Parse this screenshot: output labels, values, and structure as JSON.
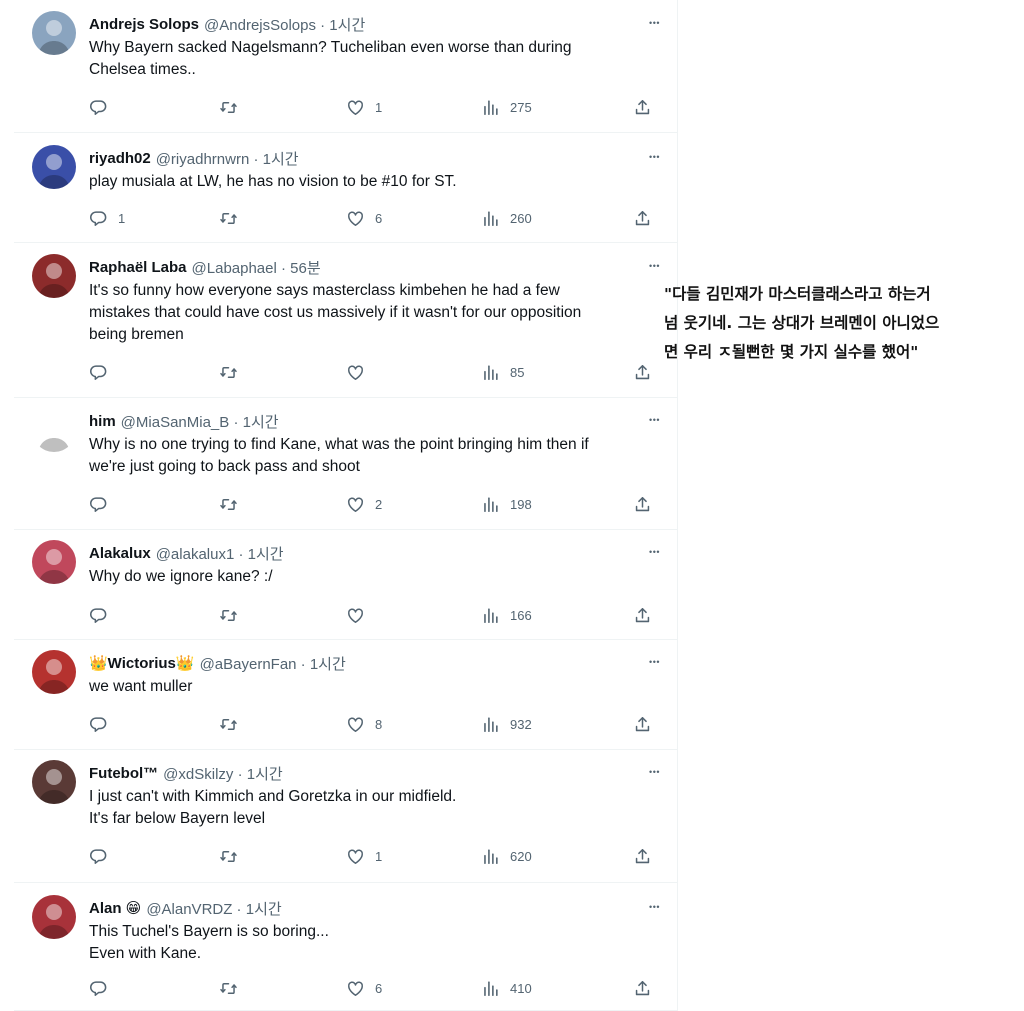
{
  "tweets": [
    {
      "name": "Andrejs Solops",
      "handle": "@AndrejsSolops · 1시간",
      "lines": [
        "Why Bayern sacked Nagelsmann? Tucheliban even worse than during",
        "Chelsea times.."
      ],
      "reply": "",
      "retweet": "",
      "like": "1",
      "views": "275",
      "avatar_color": "#8aa4bf"
    },
    {
      "name": "riyadh02",
      "handle": "@riyadhrnwrn · 1시간",
      "lines": [
        "play musiala at LW, he has no vision to be #10 for ST."
      ],
      "reply": "1",
      "retweet": "",
      "like": "6",
      "views": "260",
      "avatar_color": "#3a4fa8"
    },
    {
      "name": "Raphaël Laba",
      "handle": "@Labaphael · 56분",
      "lines": [
        "It's so funny how everyone says masterclass kimbehen he had a few",
        "mistakes that could have cost us massively if it wasn't for our opposition",
        "being bremen"
      ],
      "reply": "",
      "retweet": "",
      "like": "",
      "views": "85",
      "avatar_color": "#8c2b2b"
    },
    {
      "name": "him",
      "handle": "@MiaSanMia_B · 1시간",
      "lines": [
        "Why is no one trying to find Kane, what was the point bringing him then if",
        "we're just going to back pass and shoot"
      ],
      "reply": "",
      "retweet": "",
      "like": "2",
      "views": "198",
      "avatar_color": "#ffffff"
    },
    {
      "name": "Alakalux",
      "handle": "@alakalux1 · 1시간",
      "lines": [
        "Why  do we ignore kane? :/"
      ],
      "reply": "",
      "retweet": "",
      "like": "",
      "views": "166",
      "avatar_color": "#c0485c"
    },
    {
      "name": "👑Wictorius👑",
      "handle": "@aBayernFan · 1시간",
      "lines": [
        "we want muller"
      ],
      "reply": "",
      "retweet": "",
      "like": "8",
      "views": "932",
      "avatar_color": "#b5322f"
    },
    {
      "name": "Futebol™",
      "handle": "@xdSkilzy · 1시간",
      "lines": [
        "I just can't with Kimmich and Goretzka in our midfield.",
        "It's far below Bayern level"
      ],
      "reply": "",
      "retweet": "",
      "like": "1",
      "views": "620",
      "avatar_color": "#5a3a36"
    },
    {
      "name": "Alan 😁",
      "handle": "@AlanVRDZ · 1시간",
      "lines": [
        "This Tuchel's Bayern is so boring...",
        "Even with Kane."
      ],
      "reply": "",
      "retweet": "",
      "like": "6",
      "views": "410",
      "avatar_color": "#a8323a"
    }
  ],
  "annotation": {
    "lines": [
      "\"다들 김민재가 마스터클래스라고 하는거",
      "넘 웃기네. 그는 상대가 브레멘이 아니었으",
      "면 우리 ㅈ될뻔한 몇 가지 실수를 했어\""
    ]
  },
  "icons": {
    "reply": "reply-icon",
    "retweet": "retweet-icon",
    "like": "heart-icon",
    "views": "views-icon",
    "share": "share-icon",
    "more": "more-icon"
  },
  "colors": {
    "text": "#0f1419",
    "muted": "#536471",
    "divider": "#eff3f4"
  }
}
